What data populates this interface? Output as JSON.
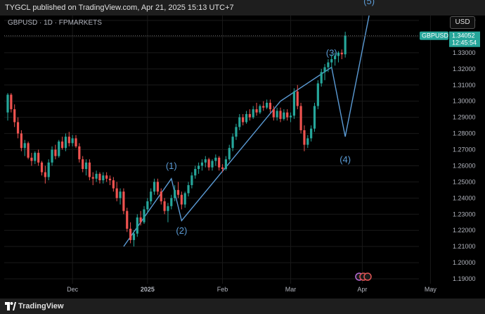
{
  "header": {
    "publisher_text": "TYGCL published on TradingView.com, Apr 21, 2025 15:13 UTC+7"
  },
  "legend": {
    "symbol_line": "GBPUSD · 1D · FPMARKETS"
  },
  "currency": "USD",
  "footer": {
    "brand": "TradingView"
  },
  "colors": {
    "up": "#26a69a",
    "down": "#ef5350",
    "wave_line": "#5b9bd5",
    "price_tag": "#26a69a",
    "background": "#000000"
  },
  "chart_data": {
    "type": "candlestick",
    "symbol": "GBPUSD",
    "timeframe": "1D",
    "y_axis": {
      "range": [
        1.185,
        1.36
      ],
      "ticks": [
        1.35,
        1.34,
        1.33,
        1.32,
        1.31,
        1.3,
        1.29,
        1.28,
        1.27,
        1.26,
        1.25,
        1.24,
        1.23,
        1.22,
        1.21,
        1.2,
        1.19
      ],
      "tick_labels": [
        "1.35000",
        "1.34000",
        "1.33000",
        "1.32000",
        "1.31000",
        "1.30000",
        "1.29000",
        "1.28000",
        "1.27000",
        "1.26000",
        "1.25000",
        "1.24000",
        "1.23000",
        "1.22000",
        "1.21000",
        "1.20000",
        "1.19000"
      ]
    },
    "x_axis": {
      "labels": [
        "Dec",
        "2025",
        "Feb",
        "Mar",
        "Apr",
        "May"
      ],
      "label_bars": [
        19,
        41,
        63,
        83,
        104,
        124
      ]
    },
    "current_price": {
      "symbol_tag": "GBPUSD",
      "price": "1.34052",
      "countdown": "12:45:54",
      "value": 1.34052
    },
    "candles_ohlc": [
      [
        1.293,
        1.305,
        1.288,
        1.304
      ],
      [
        1.304,
        1.305,
        1.293,
        1.295
      ],
      [
        1.295,
        1.298,
        1.284,
        1.287
      ],
      [
        1.287,
        1.29,
        1.277,
        1.28
      ],
      [
        1.28,
        1.282,
        1.269,
        1.271
      ],
      [
        1.271,
        1.276,
        1.266,
        1.274
      ],
      [
        1.274,
        1.275,
        1.264,
        1.265
      ],
      [
        1.265,
        1.268,
        1.26,
        1.263
      ],
      [
        1.263,
        1.269,
        1.261,
        1.268
      ],
      [
        1.268,
        1.27,
        1.26,
        1.262
      ],
      [
        1.262,
        1.263,
        1.254,
        1.256
      ],
      [
        1.256,
        1.26,
        1.249,
        1.253
      ],
      [
        1.253,
        1.264,
        1.251,
        1.262
      ],
      [
        1.262,
        1.272,
        1.26,
        1.27
      ],
      [
        1.27,
        1.273,
        1.264,
        1.266
      ],
      [
        1.266,
        1.276,
        1.265,
        1.275
      ],
      [
        1.275,
        1.278,
        1.27,
        1.271
      ],
      [
        1.271,
        1.28,
        1.269,
        1.278
      ],
      [
        1.278,
        1.281,
        1.272,
        1.274
      ],
      [
        1.274,
        1.279,
        1.272,
        1.277
      ],
      [
        1.277,
        1.279,
        1.271,
        1.272
      ],
      [
        1.272,
        1.274,
        1.262,
        1.264
      ],
      [
        1.264,
        1.266,
        1.256,
        1.258
      ],
      [
        1.258,
        1.264,
        1.254,
        1.262
      ],
      [
        1.262,
        1.264,
        1.251,
        1.253
      ],
      [
        1.253,
        1.256,
        1.248,
        1.252
      ],
      [
        1.252,
        1.257,
        1.25,
        1.255
      ],
      [
        1.255,
        1.256,
        1.249,
        1.251
      ],
      [
        1.251,
        1.256,
        1.249,
        1.254
      ],
      [
        1.254,
        1.256,
        1.25,
        1.252
      ],
      [
        1.252,
        1.254,
        1.248,
        1.251
      ],
      [
        1.251,
        1.253,
        1.244,
        1.246
      ],
      [
        1.246,
        1.25,
        1.238,
        1.24
      ],
      [
        1.24,
        1.246,
        1.236,
        1.244
      ],
      [
        1.244,
        1.246,
        1.23,
        1.232
      ],
      [
        1.232,
        1.234,
        1.219,
        1.221
      ],
      [
        1.221,
        1.225,
        1.212,
        1.214
      ],
      [
        1.214,
        1.22,
        1.21,
        1.218
      ],
      [
        1.218,
        1.23,
        1.216,
        1.228
      ],
      [
        1.228,
        1.232,
        1.223,
        1.225
      ],
      [
        1.225,
        1.235,
        1.224,
        1.233
      ],
      [
        1.233,
        1.24,
        1.231,
        1.238
      ],
      [
        1.238,
        1.246,
        1.236,
        1.244
      ],
      [
        1.244,
        1.252,
        1.242,
        1.25
      ],
      [
        1.25,
        1.252,
        1.242,
        1.244
      ],
      [
        1.244,
        1.246,
        1.236,
        1.238
      ],
      [
        1.238,
        1.24,
        1.23,
        1.232
      ],
      [
        1.232,
        1.237,
        1.225,
        1.235
      ],
      [
        1.235,
        1.242,
        1.233,
        1.24
      ],
      [
        1.24,
        1.248,
        1.238,
        1.245
      ],
      [
        1.245,
        1.25,
        1.24,
        1.242
      ],
      [
        1.242,
        1.244,
        1.233,
        1.236
      ],
      [
        1.236,
        1.244,
        1.234,
        1.243
      ],
      [
        1.243,
        1.25,
        1.241,
        1.248
      ],
      [
        1.248,
        1.256,
        1.246,
        1.254
      ],
      [
        1.254,
        1.26,
        1.252,
        1.258
      ],
      [
        1.258,
        1.262,
        1.255,
        1.26
      ],
      [
        1.26,
        1.264,
        1.257,
        1.262
      ],
      [
        1.262,
        1.266,
        1.259,
        1.264
      ],
      [
        1.264,
        1.265,
        1.257,
        1.259
      ],
      [
        1.259,
        1.264,
        1.257,
        1.263
      ],
      [
        1.263,
        1.267,
        1.26,
        1.265
      ],
      [
        1.265,
        1.266,
        1.257,
        1.259
      ],
      [
        1.259,
        1.261,
        1.256,
        1.258
      ],
      [
        1.258,
        1.266,
        1.257,
        1.264
      ],
      [
        1.264,
        1.273,
        1.263,
        1.271
      ],
      [
        1.271,
        1.28,
        1.269,
        1.278
      ],
      [
        1.278,
        1.286,
        1.276,
        1.284
      ],
      [
        1.284,
        1.292,
        1.282,
        1.29
      ],
      [
        1.29,
        1.292,
        1.285,
        1.287
      ],
      [
        1.287,
        1.294,
        1.286,
        1.292
      ],
      [
        1.292,
        1.295,
        1.288,
        1.29
      ],
      [
        1.29,
        1.297,
        1.289,
        1.295
      ],
      [
        1.295,
        1.299,
        1.291,
        1.293
      ],
      [
        1.293,
        1.298,
        1.292,
        1.297
      ],
      [
        1.297,
        1.3,
        1.294,
        1.296
      ],
      [
        1.296,
        1.301,
        1.295,
        1.299
      ],
      [
        1.299,
        1.301,
        1.293,
        1.295
      ],
      [
        1.295,
        1.297,
        1.288,
        1.29
      ],
      [
        1.29,
        1.296,
        1.288,
        1.294
      ],
      [
        1.294,
        1.296,
        1.287,
        1.289
      ],
      [
        1.289,
        1.295,
        1.288,
        1.293
      ],
      [
        1.293,
        1.295,
        1.288,
        1.29
      ],
      [
        1.29,
        1.293,
        1.287,
        1.291
      ],
      [
        1.291,
        1.308,
        1.289,
        1.306
      ],
      [
        1.306,
        1.31,
        1.295,
        1.297
      ],
      [
        1.297,
        1.299,
        1.28,
        1.282
      ],
      [
        1.282,
        1.285,
        1.269,
        1.273
      ],
      [
        1.273,
        1.279,
        1.271,
        1.277
      ],
      [
        1.277,
        1.285,
        1.275,
        1.283
      ],
      [
        1.283,
        1.299,
        1.281,
        1.297
      ],
      [
        1.297,
        1.313,
        1.295,
        1.311
      ],
      [
        1.311,
        1.32,
        1.309,
        1.318
      ],
      [
        1.318,
        1.323,
        1.313,
        1.321
      ],
      [
        1.321,
        1.326,
        1.318,
        1.324
      ],
      [
        1.324,
        1.329,
        1.32,
        1.326
      ],
      [
        1.326,
        1.33,
        1.322,
        1.328
      ],
      [
        1.328,
        1.331,
        1.324,
        1.33
      ],
      [
        1.33,
        1.332,
        1.326,
        1.329
      ],
      [
        1.329,
        1.343,
        1.327,
        1.3405
      ]
    ],
    "elliott_wave": {
      "line_points": [
        [
          1.21,
          34
        ],
        [
          1.252,
          48
        ],
        [
          1.226,
          51
        ],
        [
          1.3,
          80
        ],
        [
          1.321,
          95
        ],
        [
          1.278,
          99
        ],
        [
          1.353,
          106
        ]
      ],
      "labels": [
        {
          "text": "(1)",
          "bar": 48,
          "price": 1.258
        },
        {
          "text": "(2)",
          "bar": 51,
          "price": 1.218
        },
        {
          "text": "(3)",
          "bar": 95,
          "price": 1.328
        },
        {
          "text": "(4)",
          "bar": 99,
          "price": 1.262
        },
        {
          "text": "(5)",
          "bar": 106,
          "price": 1.36
        }
      ]
    }
  }
}
